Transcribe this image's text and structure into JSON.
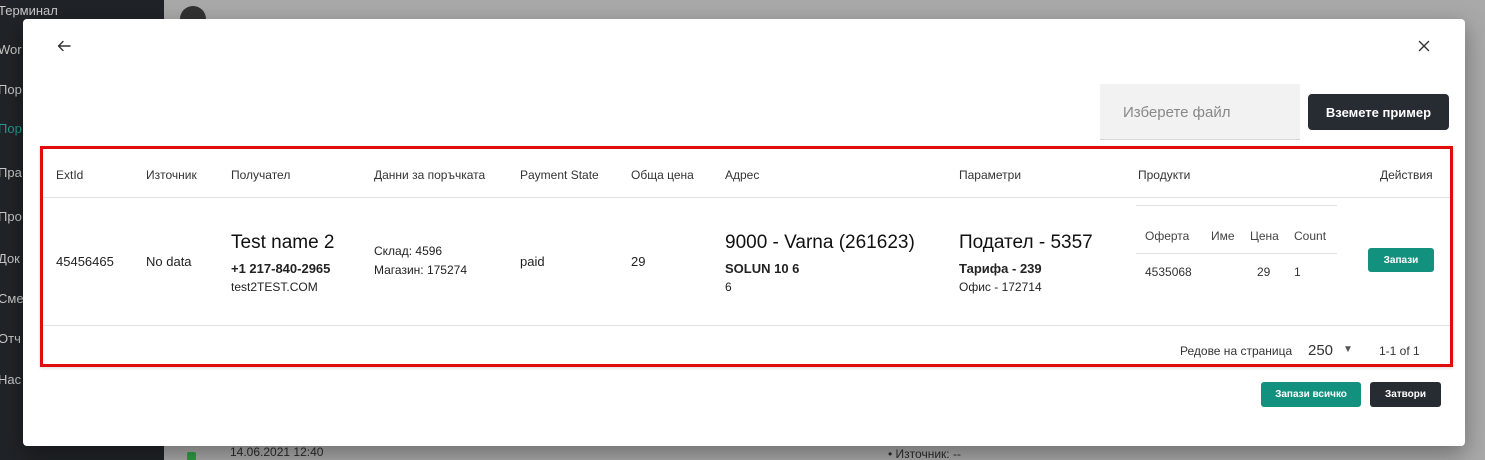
{
  "background": {
    "sidebar_items": [
      "Терминал",
      "Wor",
      "Пор",
      "Пор",
      "Пра",
      "Про",
      "Док",
      "Сме",
      "Отч",
      "Нас"
    ],
    "row_date": "14.06.2021 12:40",
    "row_source": "Източник: --"
  },
  "modal": {
    "file_placeholder": "Изберете файл",
    "example_button": "Вземете пример",
    "columns": [
      "ExtId",
      "Източник",
      "Получател",
      "Данни за поръчката",
      "Payment State",
      "Обща цена",
      "Адрес",
      "Параметри",
      "Продукти",
      "Действия"
    ],
    "row": {
      "ext_id": "45456465",
      "source": "No data",
      "recipient_name": "Test name 2",
      "recipient_phone": "+1 217-840-2965",
      "recipient_email": "test2TEST.COM",
      "order_warehouse": "Склад: 4596",
      "order_store": "Магазин: 175274",
      "payment_state": "paid",
      "total_price": "29",
      "address_title": "9000 - Varna (261623)",
      "address_street": "SOLUN 10 6",
      "address_extra": "6",
      "params_sender": "Подател - 5357",
      "params_tariff": "Тарифа - 239",
      "params_office": "Офис - 172714",
      "products": {
        "columns": [
          "Оферта",
          "Име",
          "Цена",
          "Count"
        ],
        "rows": [
          [
            "4535068",
            "",
            "29",
            "1"
          ]
        ]
      },
      "save_button": "Запази"
    },
    "pagination": {
      "rows_per_page_label": "Редове на страница",
      "rows_per_page_value": "250",
      "page_info": "1-1 of 1"
    },
    "save_all_button": "Запази всичко",
    "close_button": "Затвори"
  }
}
